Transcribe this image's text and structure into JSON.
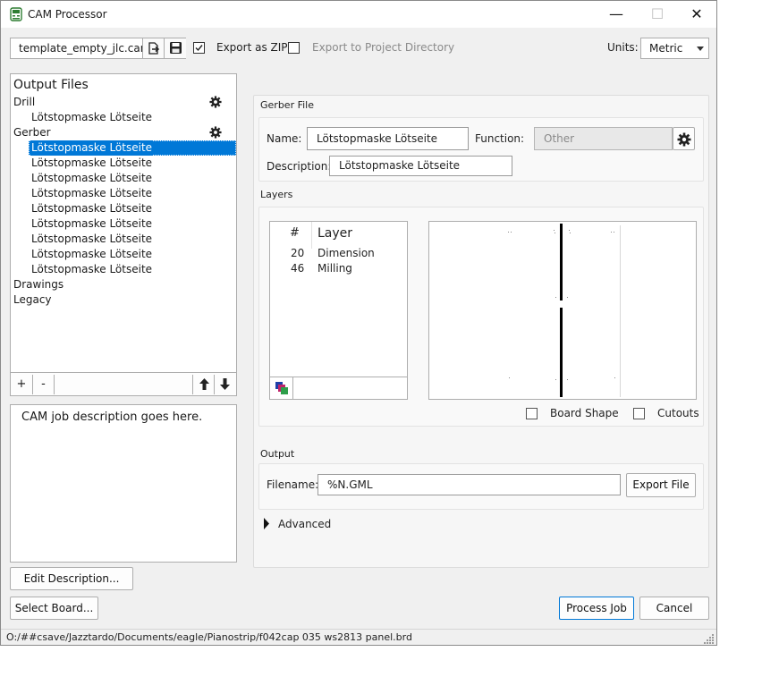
{
  "window": {
    "title": "CAM Processor"
  },
  "toolbar": {
    "template_name": "template_empty_jlc.cam",
    "export_zip_label": "Export as ZIP",
    "export_zip_checked": true,
    "export_project_dir_label": "Export to Project Directory",
    "export_project_dir_checked": false,
    "units_label": "Units:",
    "units_value": "Metric"
  },
  "output_files": {
    "header": "Output Files",
    "rows": [
      {
        "label": "Drill",
        "level": 0,
        "has_gear": true,
        "selected": false
      },
      {
        "label": "Lötstopmaske Lötseite",
        "level": 1,
        "has_gear": false,
        "selected": false
      },
      {
        "label": "Gerber",
        "level": 0,
        "has_gear": true,
        "selected": false
      },
      {
        "label": "Lötstopmaske Lötseite",
        "level": 1,
        "has_gear": false,
        "selected": true
      },
      {
        "label": "Lötstopmaske Lötseite",
        "level": 1,
        "has_gear": false,
        "selected": false
      },
      {
        "label": "Lötstopmaske Lötseite",
        "level": 1,
        "has_gear": false,
        "selected": false
      },
      {
        "label": "Lötstopmaske Lötseite",
        "level": 1,
        "has_gear": false,
        "selected": false
      },
      {
        "label": "Lötstopmaske Lötseite",
        "level": 1,
        "has_gear": false,
        "selected": false
      },
      {
        "label": "Lötstopmaske Lötseite",
        "level": 1,
        "has_gear": false,
        "selected": false
      },
      {
        "label": "Lötstopmaske Lötseite",
        "level": 1,
        "has_gear": false,
        "selected": false
      },
      {
        "label": "Lötstopmaske Lötseite",
        "level": 1,
        "has_gear": false,
        "selected": false
      },
      {
        "label": "Lötstopmaske Lötseite",
        "level": 1,
        "has_gear": false,
        "selected": false
      },
      {
        "label": "Drawings",
        "level": 0,
        "has_gear": false,
        "selected": false
      },
      {
        "label": "Legacy",
        "level": 0,
        "has_gear": false,
        "selected": false
      }
    ],
    "add_label": "+",
    "remove_label": "-"
  },
  "description": {
    "text": "CAM job description goes here.",
    "edit_button": "Edit Description..."
  },
  "gerber_file": {
    "group_title": "Gerber File",
    "name_label": "Name:",
    "name_value": "Lötstopmaske Lötseite",
    "function_label": "Function:",
    "function_value": "Other",
    "description_label": "Description:",
    "description_value": "Lötstopmaske Lötseite"
  },
  "layers": {
    "group_title": "Layers",
    "col_number": "#",
    "col_layer": "Layer",
    "rows": [
      {
        "number": "20",
        "name": "Dimension"
      },
      {
        "number": "46",
        "name": "Milling"
      }
    ],
    "board_shape_label": "Board Shape",
    "board_shape_checked": false,
    "cutouts_label": "Cutouts",
    "cutouts_checked": false
  },
  "output": {
    "group_title": "Output",
    "filename_label": "Filename:",
    "filename_value": "%N.GML",
    "export_file_button": "Export File"
  },
  "advanced": {
    "label": "Advanced"
  },
  "footer": {
    "select_board_button": "Select Board...",
    "process_job_button": "Process Job",
    "cancel_button": "Cancel",
    "status_path": "O:/##csave/Jazztardo/Documents/eagle/Pianostrip/f042cap 035 ws2813 panel.brd"
  },
  "colors": {
    "accent": "#0078d7",
    "window_bg": "#f0f0f0"
  }
}
